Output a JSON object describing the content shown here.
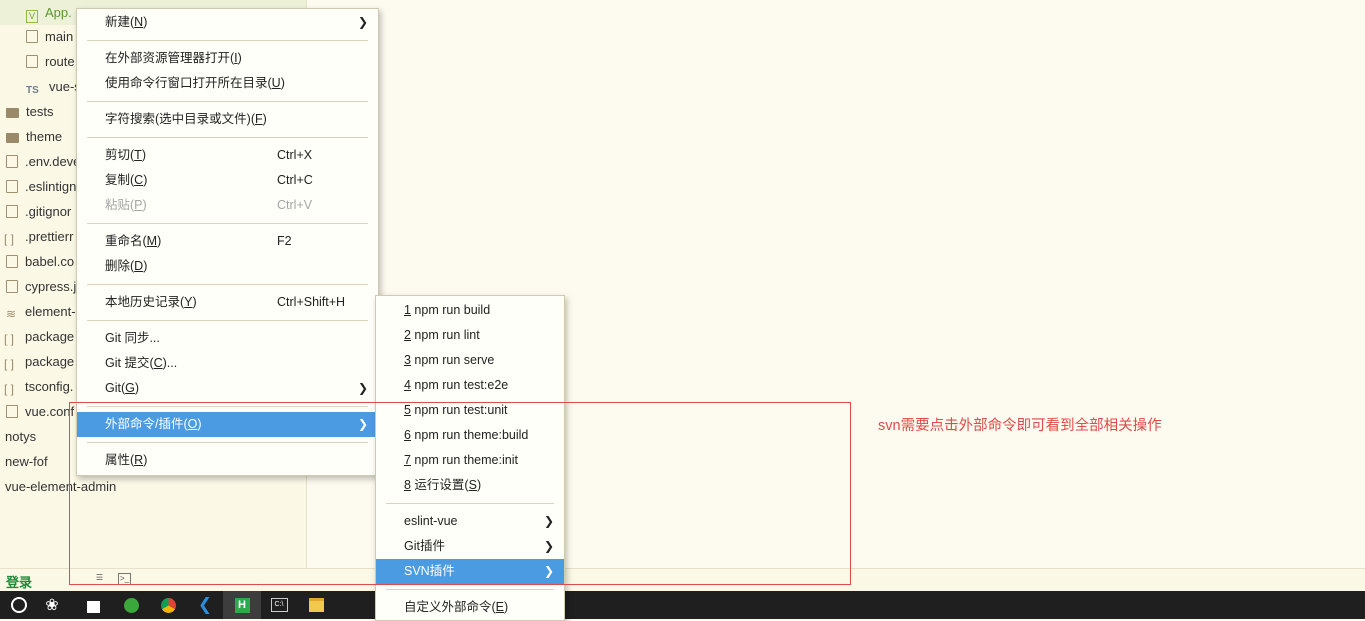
{
  "tree": {
    "items": [
      {
        "label": "App.",
        "icon": "vue-file-icon"
      },
      {
        "label": "main",
        "icon": "file-icon"
      },
      {
        "label": "route",
        "icon": "file-icon"
      },
      {
        "label": "vue-s",
        "icon": "ts-file-icon",
        "badge": "TS"
      },
      {
        "label": "tests",
        "icon": "folder-icon"
      },
      {
        "label": "theme",
        "icon": "folder-icon"
      },
      {
        "label": ".env.deve",
        "icon": "file-icon"
      },
      {
        "label": ".eslintign",
        "icon": "file-icon"
      },
      {
        "label": ".gitignor",
        "icon": "file-icon"
      },
      {
        "label": ".prettierr",
        "icon": "json-file-icon"
      },
      {
        "label": "babel.co",
        "icon": "file-icon"
      },
      {
        "label": "cypress.j",
        "icon": "file-icon"
      },
      {
        "label": "element-",
        "icon": "link-icon"
      },
      {
        "label": "package",
        "icon": "json-file-icon"
      },
      {
        "label": "package",
        "icon": "json-file-icon"
      },
      {
        "label": "tsconfig.",
        "icon": "json-file-icon"
      },
      {
        "label": "vue.conf",
        "icon": "file-icon"
      },
      {
        "label": "notys",
        "icon": ""
      },
      {
        "label": "new-fof",
        "icon": ""
      },
      {
        "label": "vue-element-admin",
        "icon": ""
      }
    ]
  },
  "menu": {
    "items": [
      {
        "label": "新建(",
        "mn": "N",
        "tail": ")",
        "shortcut": "",
        "submenu": true
      },
      {
        "label": "在外部资源管理器打开(",
        "mn": "I",
        "tail": ")",
        "shortcut": ""
      },
      {
        "label": "使用命令行窗口打开所在目录(",
        "mn": "U",
        "tail": ")",
        "shortcut": ""
      },
      {
        "label": "字符搜索(选中目录或文件)(",
        "mn": "F",
        "tail": ")",
        "shortcut": ""
      },
      {
        "label": "剪切(",
        "mn": "T",
        "tail": ")",
        "shortcut": "Ctrl+X"
      },
      {
        "label": "复制(",
        "mn": "C",
        "tail": ")",
        "shortcut": "Ctrl+C"
      },
      {
        "label": "粘贴(",
        "mn": "P",
        "tail": ")",
        "shortcut": "Ctrl+V",
        "disabled": true
      },
      {
        "label": "重命名(",
        "mn": "M",
        "tail": ")",
        "shortcut": "F2"
      },
      {
        "label": "删除(",
        "mn": "D",
        "tail": ")",
        "shortcut": ""
      },
      {
        "label": "本地历史记录(",
        "mn": "Y",
        "tail": ")",
        "shortcut": "Ctrl+Shift+H"
      },
      {
        "label": "Git 同步...",
        "mn": "",
        "tail": "",
        "shortcut": ""
      },
      {
        "label": "Git 提交(",
        "mn": "C",
        "tail": ")...",
        "shortcut": ""
      },
      {
        "label": "Git(",
        "mn": "G",
        "tail": ")",
        "shortcut": "",
        "submenu": true
      },
      {
        "label": "外部命令/插件(",
        "mn": "O",
        "tail": ")",
        "shortcut": "",
        "submenu": true,
        "highlighted": true
      },
      {
        "label": "属性(",
        "mn": "R",
        "tail": ")",
        "shortcut": ""
      }
    ]
  },
  "submenu": {
    "items": [
      {
        "num": "1",
        "label": " npm run build"
      },
      {
        "num": "2",
        "label": " npm run lint"
      },
      {
        "num": "3",
        "label": " npm run serve"
      },
      {
        "num": "4",
        "label": " npm run test:e2e"
      },
      {
        "num": "5",
        "label": " npm run test:unit"
      },
      {
        "num": "6",
        "label": " npm run theme:build"
      },
      {
        "num": "7",
        "label": " npm run theme:init"
      },
      {
        "num": "8",
        "label": " 运行设置(",
        "mn": "S",
        "tail": ")"
      },
      {
        "num": "",
        "label": "eslint-vue",
        "submenu": true
      },
      {
        "num": "",
        "label": "Git插件",
        "submenu": true
      },
      {
        "num": "",
        "label": "SVN插件",
        "submenu": true,
        "highlighted": true
      },
      {
        "num": "",
        "label": "自定义外部命令(",
        "mn": "E",
        "tail": ")"
      }
    ]
  },
  "annotation": {
    "text": "svn需要点击外部命令即可看到全部相关操作",
    "color": "#e04a4a"
  },
  "statusbar": {
    "login": "登录"
  },
  "taskbar": {
    "apps": [
      "cortana-icon",
      "fan-icon",
      "store-icon",
      "edge-browser-icon",
      "chrome-icon",
      "vscode-icon",
      "hbuilder-icon",
      "terminal-icon",
      "file-explorer-icon"
    ]
  },
  "colors": {
    "highlight": "#4b9be3",
    "background": "#fdfbf0",
    "annotation": "#e04a4a"
  }
}
